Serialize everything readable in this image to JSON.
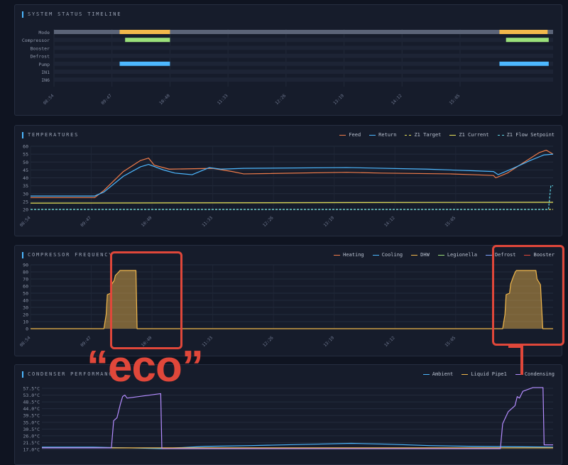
{
  "panels": {
    "timeline": {
      "title": "SYSTEM STATUS TIMELINE"
    },
    "temperatures": {
      "title": "TEMPERATURES",
      "legend": [
        {
          "name": "Feed",
          "color": "#f07c4a",
          "dash": false
        },
        {
          "name": "Return",
          "color": "#4db8ff",
          "dash": false
        },
        {
          "name": "Z1 Target",
          "color": "#e8e25a",
          "dash": true
        },
        {
          "name": "Z1 Current",
          "color": "#e8e25a",
          "dash": false
        },
        {
          "name": "Z1 Flow Setpoint",
          "color": "#5fd6e6",
          "dash": true
        }
      ]
    },
    "compressor": {
      "title": "COMPRESSOR FREQUENCY",
      "legend": [
        {
          "name": "Heating",
          "color": "#f07c4a",
          "dash": false
        },
        {
          "name": "Cooling",
          "color": "#4db8ff",
          "dash": false
        },
        {
          "name": "DHW",
          "color": "#f2b84b",
          "dash": false
        },
        {
          "name": "Legionella",
          "color": "#9be07a",
          "dash": false
        },
        {
          "name": "Defrost",
          "color": "#7ea3ff",
          "dash": false
        },
        {
          "name": "Booster",
          "color": "#e0473a",
          "dash": false
        }
      ]
    },
    "condenser": {
      "title": "CONDENSER PERFORMANCE",
      "legend": [
        {
          "name": "Ambient",
          "color": "#4db8ff",
          "dash": false
        },
        {
          "name": "Liquid Pipe1",
          "color": "#f2b84b",
          "dash": false
        },
        {
          "name": "Condensing",
          "color": "#b48cff",
          "dash": false
        }
      ]
    }
  },
  "annotation": {
    "text": "“eco”",
    "color": "#e0473a"
  },
  "chart_data": [
    {
      "type": "timeline",
      "title": "SYSTEM STATUS TIMELINE",
      "x_ticks": [
        "08:54",
        "09:47",
        "10:40",
        "11:33",
        "12:26",
        "13:19",
        "14:12",
        "15:05"
      ],
      "x_range": [
        "08:54",
        "16:20"
      ],
      "rows": [
        {
          "label": "Mode",
          "base_color": "#5b6478",
          "segments": [
            {
              "start": "09:54",
              "end": "10:40",
              "color": "#f2b84b"
            },
            {
              "start": "15:41",
              "end": "16:25",
              "color": "#f2b84b"
            }
          ]
        },
        {
          "label": "Compressor",
          "segments": [
            {
              "start": "09:59",
              "end": "10:40",
              "color": "#9be07a"
            },
            {
              "start": "15:47",
              "end": "16:26",
              "color": "#9be07a"
            }
          ]
        },
        {
          "label": "Booster",
          "segments": []
        },
        {
          "label": "Defrost",
          "segments": []
        },
        {
          "label": "Pump",
          "segments": [
            {
              "start": "09:54",
              "end": "10:40",
              "color": "#4db8ff"
            },
            {
              "start": "15:41",
              "end": "16:26",
              "color": "#4db8ff"
            }
          ]
        },
        {
          "label": "IN1",
          "segments": []
        },
        {
          "label": "IN6",
          "segments": []
        }
      ]
    },
    {
      "type": "line",
      "title": "TEMPERATURES",
      "x_ticks": [
        "08:54",
        "09:47",
        "10:40",
        "11:33",
        "12:26",
        "13:19",
        "14:12",
        "15:05"
      ],
      "y_ticks": [
        20,
        25,
        30,
        35,
        40,
        45,
        50,
        55,
        60
      ],
      "ylim": [
        20,
        60
      ],
      "series": [
        {
          "name": "Feed",
          "color": "#f07c4a",
          "dash": false,
          "points": [
            [
              "08:54",
              27.5
            ],
            [
              "09:50",
              27.5
            ],
            [
              "09:58",
              32
            ],
            [
              "10:15",
              44
            ],
            [
              "10:30",
              51
            ],
            [
              "10:37",
              52.5
            ],
            [
              "10:42",
              48
            ],
            [
              "10:55",
              45.5
            ],
            [
              "11:33",
              46
            ],
            [
              "11:50",
              44
            ],
            [
              "12:00",
              42.5
            ],
            [
              "13:30",
              43.5
            ],
            [
              "14:00",
              43
            ],
            [
              "15:00",
              42.5
            ],
            [
              "15:20",
              42
            ],
            [
              "15:38",
              41.5
            ],
            [
              "15:40",
              40
            ],
            [
              "15:50",
              43
            ],
            [
              "16:05",
              50
            ],
            [
              "16:18",
              56
            ],
            [
              "16:24",
              57.5
            ],
            [
              "16:30",
              55
            ]
          ]
        },
        {
          "name": "Return",
          "color": "#4db8ff",
          "dash": false,
          "points": [
            [
              "08:54",
              28.5
            ],
            [
              "09:50",
              28.5
            ],
            [
              "09:58",
              31
            ],
            [
              "10:15",
              41
            ],
            [
              "10:30",
              47
            ],
            [
              "10:37",
              48.5
            ],
            [
              "10:50",
              45
            ],
            [
              "11:00",
              43
            ],
            [
              "11:15",
              42
            ],
            [
              "11:30",
              46.5
            ],
            [
              "11:40",
              45.5
            ],
            [
              "12:00",
              46
            ],
            [
              "13:30",
              46.5
            ],
            [
              "14:40",
              45.5
            ],
            [
              "15:20",
              44.5
            ],
            [
              "15:38",
              44
            ],
            [
              "15:42",
              42
            ],
            [
              "15:55",
              46
            ],
            [
              "16:10",
              51
            ],
            [
              "16:22",
              54.5
            ],
            [
              "16:30",
              55
            ]
          ]
        },
        {
          "name": "Z1 Target",
          "color": "#e8e25a",
          "dash": true,
          "points": [
            [
              "08:54",
              20
            ],
            [
              "16:30",
              20
            ]
          ]
        },
        {
          "name": "Z1 Current",
          "color": "#e8e25a",
          "dash": false,
          "points": [
            [
              "08:54",
              24
            ],
            [
              "16:30",
              24.5
            ]
          ]
        },
        {
          "name": "Z1 Flow Setpoint",
          "color": "#5fd6e6",
          "dash": true,
          "points": [
            [
              "08:54",
              20
            ],
            [
              "16:26",
              20
            ],
            [
              "16:28",
              35
            ],
            [
              "16:30",
              35
            ]
          ]
        }
      ]
    },
    {
      "type": "area",
      "title": "COMPRESSOR FREQUENCY",
      "x_ticks": [
        "08:54",
        "09:47",
        "10:40",
        "11:33",
        "12:26",
        "13:19",
        "14:12",
        "15:05"
      ],
      "y_ticks": [
        0,
        10,
        20,
        30,
        40,
        50,
        60,
        70,
        80,
        90
      ],
      "ylim": [
        0,
        90
      ],
      "series": [
        {
          "name": "DHW",
          "color": "#f2b84b",
          "points": [
            [
              "08:54",
              0
            ],
            [
              "09:58",
              0
            ],
            [
              "10:00",
              20
            ],
            [
              "10:01",
              48
            ],
            [
              "10:04",
              50
            ],
            [
              "10:05",
              63
            ],
            [
              "10:07",
              68
            ],
            [
              "10:08",
              75
            ],
            [
              "10:11",
              80
            ],
            [
              "10:12",
              82
            ],
            [
              "10:26",
              82
            ],
            [
              "10:27",
              0
            ],
            [
              "15:46",
              0
            ],
            [
              "15:48",
              20
            ],
            [
              "15:49",
              48
            ],
            [
              "15:52",
              50
            ],
            [
              "15:53",
              63
            ],
            [
              "15:55",
              72
            ],
            [
              "15:57",
              80
            ],
            [
              "15:58",
              82
            ],
            [
              "16:15",
              82
            ],
            [
              "16:16",
              70
            ],
            [
              "16:19",
              62
            ],
            [
              "16:21",
              0
            ],
            [
              "16:30",
              0
            ]
          ]
        }
      ]
    },
    {
      "type": "line",
      "title": "CONDENSER PERFORMANCE",
      "y_ticks": [
        "17.0°C",
        "21.5°C",
        "26.0°C",
        "30.5°C",
        "35.0°C",
        "39.5°C",
        "44.0°C",
        "48.5°C",
        "53.0°C",
        "57.5°C"
      ],
      "ylim": [
        17,
        57.5
      ],
      "series": [
        {
          "name": "Ambient",
          "color": "#4db8ff",
          "points": [
            [
              "08:54",
              18.5
            ],
            [
              "09:40",
              18.5
            ],
            [
              "10:40",
              17.5
            ],
            [
              "11:20",
              19
            ],
            [
              "12:00",
              19.5
            ],
            [
              "13:00",
              20.5
            ],
            [
              "13:30",
              21
            ],
            [
              "14:00",
              20.5
            ],
            [
              "14:40",
              19.5
            ],
            [
              "15:20",
              19
            ],
            [
              "16:30",
              18.5
            ]
          ]
        },
        {
          "name": "Liquid Pipe1",
          "color": "#f2b84b",
          "points": [
            [
              "08:54",
              18
            ],
            [
              "16:30",
              18
            ]
          ]
        },
        {
          "name": "Condensing",
          "color": "#b48cff",
          "points": [
            [
              "08:54",
              18
            ],
            [
              "09:56",
              18
            ],
            [
              "09:58",
              36
            ],
            [
              "10:01",
              38
            ],
            [
              "10:04",
              47
            ],
            [
              "10:06",
              52
            ],
            [
              "10:08",
              53
            ],
            [
              "10:10",
              51
            ],
            [
              "10:40",
              54
            ],
            [
              "10:41",
              17.5
            ],
            [
              "15:43",
              17.5
            ],
            [
              "15:45",
              34
            ],
            [
              "15:50",
              42
            ],
            [
              "15:56",
              46
            ],
            [
              "15:58",
              52
            ],
            [
              "16:00",
              51
            ],
            [
              "16:03",
              55.5
            ],
            [
              "16:12",
              58
            ],
            [
              "16:21",
              58
            ],
            [
              "16:22",
              20
            ],
            [
              "16:30",
              20
            ]
          ]
        }
      ]
    }
  ]
}
